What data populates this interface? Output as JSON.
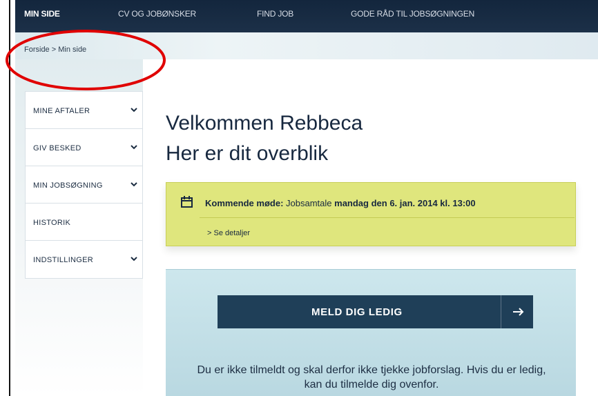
{
  "top_nav": {
    "items": [
      {
        "label": "MIN SIDE",
        "active": true
      },
      {
        "label": "CV OG JOBØNSKER",
        "active": false
      },
      {
        "label": "FIND JOB",
        "active": false
      },
      {
        "label": "GODE RÅD TIL JOBSØGNINGEN",
        "active": false
      }
    ]
  },
  "breadcrumb": {
    "text": "Forside > Min side"
  },
  "sidebar": {
    "items": [
      {
        "label": "MINE AFTALER",
        "icon": "chevron-down-icon"
      },
      {
        "label": "GIV BESKED",
        "icon": "chevron-down-icon"
      },
      {
        "label": "MIN JOBSØGNING",
        "icon": "chevron-down-icon"
      },
      {
        "label": "HISTORIK",
        "icon": ""
      },
      {
        "label": "INDSTILLINGER",
        "icon": "chevron-down-icon"
      }
    ]
  },
  "main": {
    "title": "Velkommen Rebbeca",
    "subtitle": "Her er dit overblik"
  },
  "meeting": {
    "icon": "calendar-icon",
    "label": "Kommende møde:",
    "type": "Jobsamtale",
    "date_time": "mandag den 6. jan. 2014 kl. 13:00",
    "link": "> Se detaljer"
  },
  "signup": {
    "button_label": "MELD DIG LEDIG",
    "button_icon": "arrow-right-icon",
    "notice": "Du er ikke tilmeldt og skal derfor ikke tjekke jobforslag. Hvis du er ledig, kan du tilmelde dig ovenfor."
  },
  "colors": {
    "nav_background": "#13263d",
    "highlight_green": "#dfe67d",
    "panel_blue": "#c6e1e8",
    "primary_button": "#1f3f58",
    "annotation_red": "#e00000"
  }
}
